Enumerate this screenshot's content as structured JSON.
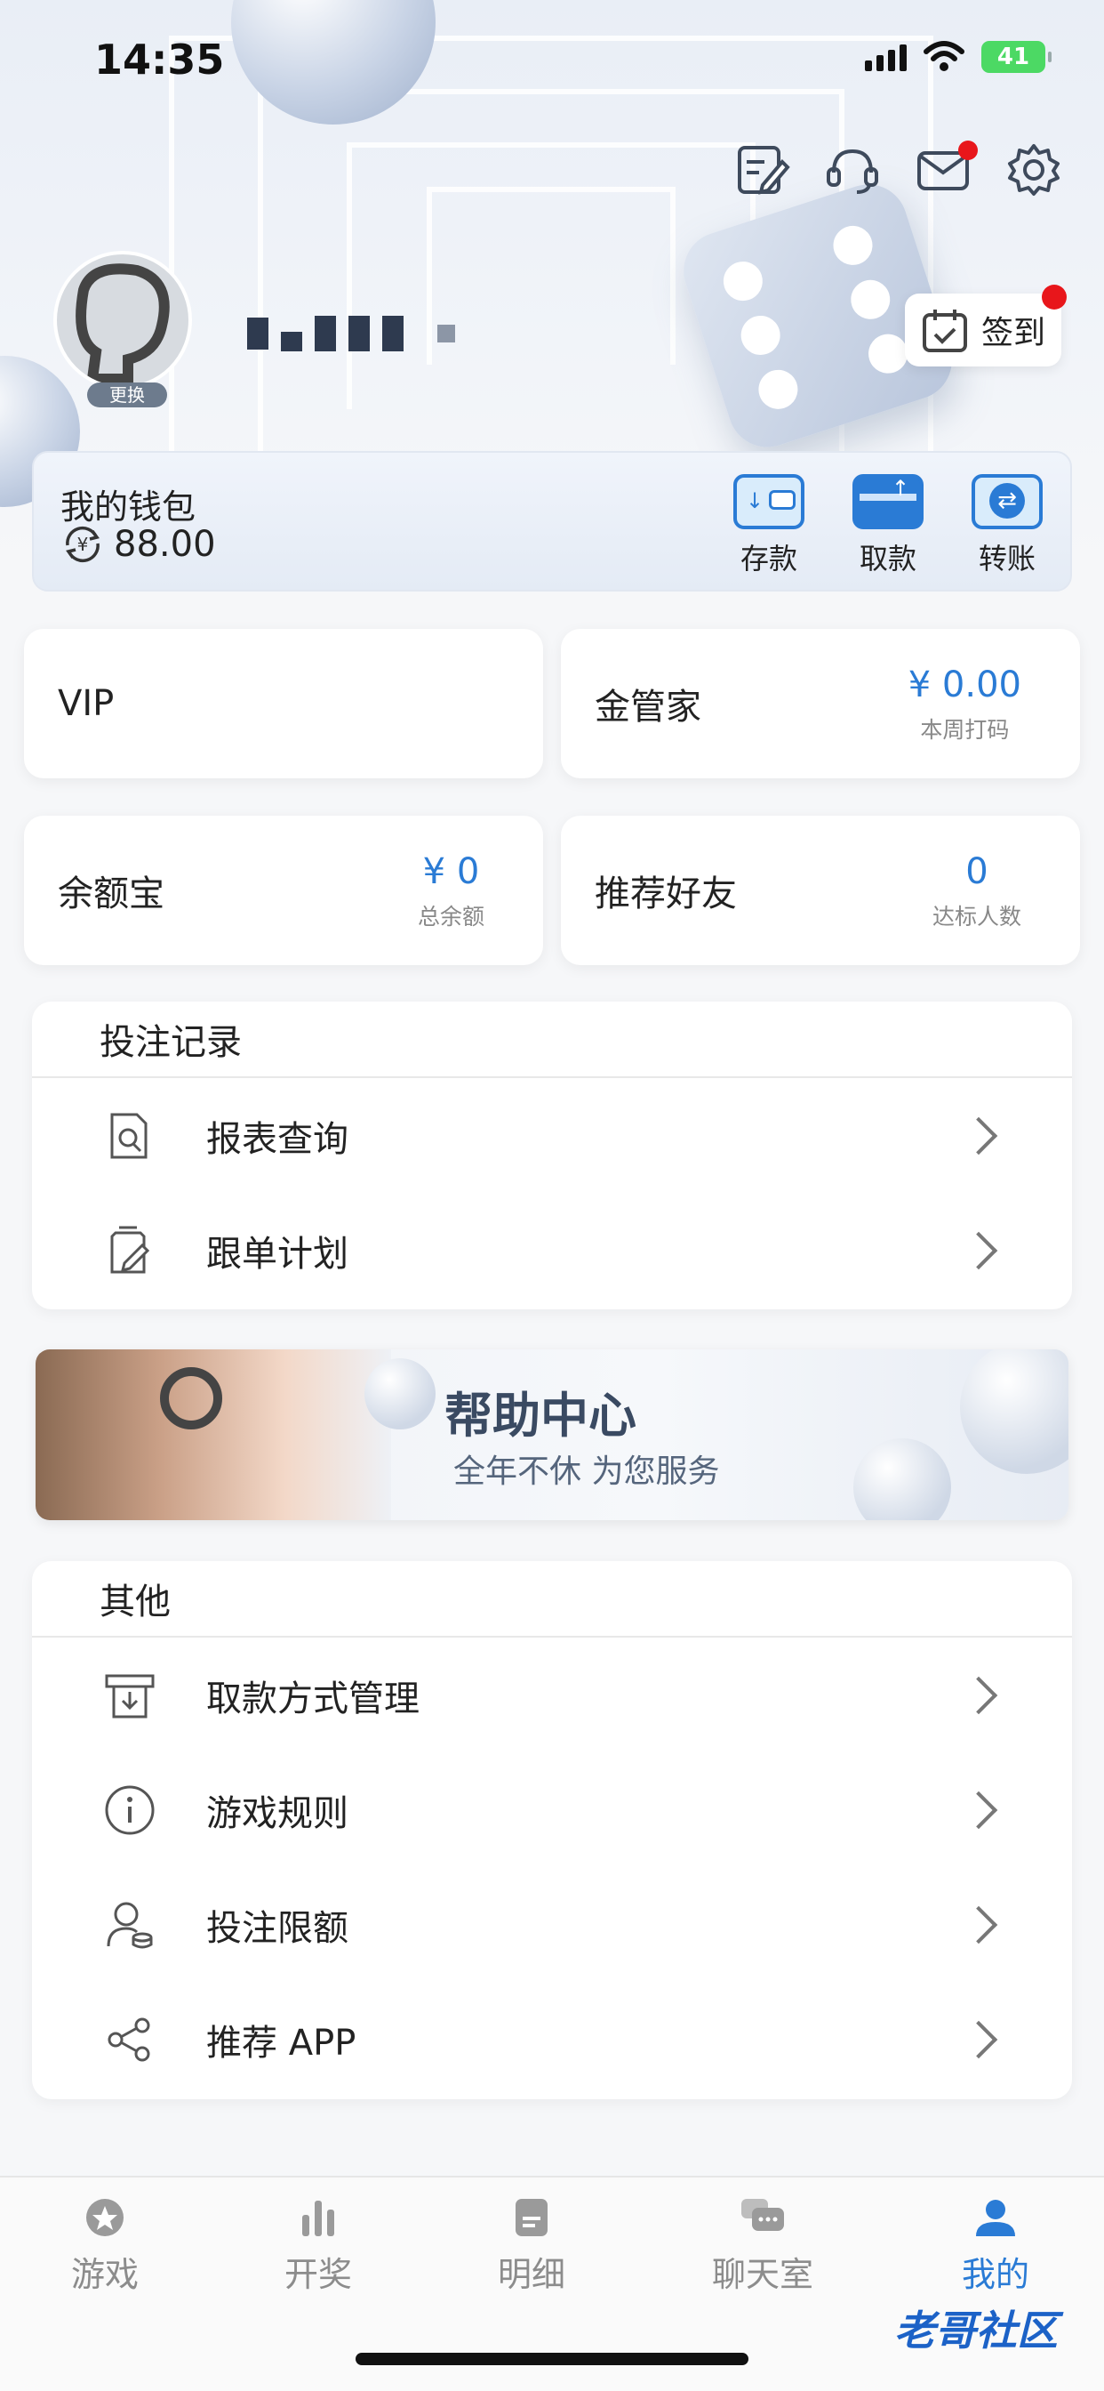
{
  "status_bar": {
    "time": "14:35",
    "battery": "41"
  },
  "header": {
    "avatar_change_label": "更换",
    "checkin_label": "签到"
  },
  "wallet": {
    "title": "我的钱包",
    "balance": "88.00",
    "actions": [
      {
        "label": "存款",
        "icon": "deposit-icon"
      },
      {
        "label": "取款",
        "icon": "withdraw-card-icon"
      },
      {
        "label": "转账",
        "icon": "transfer-icon"
      }
    ]
  },
  "cards": {
    "vip": {
      "label": "VIP"
    },
    "steward": {
      "label": "金管家",
      "value": "¥ 0.00",
      "sub": "本周打码"
    },
    "yuebao": {
      "label": "余额宝",
      "value": "¥ 0",
      "sub": "总余额"
    },
    "referral": {
      "label": "推荐好友",
      "value": "0",
      "sub": "达标人数"
    }
  },
  "bet_records": {
    "title": "投注记录",
    "items": [
      {
        "label": "报表查询",
        "icon": "report-search-icon"
      },
      {
        "label": "跟单计划",
        "icon": "follow-plan-icon"
      }
    ]
  },
  "banner": {
    "title": "帮助中心",
    "subtitle": "全年不休 为您服务"
  },
  "others": {
    "title": "其他",
    "items": [
      {
        "label": "取款方式管理",
        "icon": "withdraw-method-icon"
      },
      {
        "label": "游戏规则",
        "icon": "info-icon"
      },
      {
        "label": "投注限额",
        "icon": "bet-limit-icon"
      },
      {
        "label": "推荐 APP",
        "icon": "share-icon"
      }
    ]
  },
  "tabs": [
    {
      "label": "游戏",
      "icon": "game-icon",
      "active": false
    },
    {
      "label": "开奖",
      "icon": "chart-bars-icon",
      "active": false
    },
    {
      "label": "明细",
      "icon": "document-icon",
      "active": false
    },
    {
      "label": "聊天室",
      "icon": "chat-icon",
      "active": false
    },
    {
      "label": "我的",
      "icon": "user-icon",
      "active": true
    }
  ],
  "watermark": "老哥社区",
  "colors": {
    "accent": "#2a7bd5",
    "badge": "#e8161b"
  }
}
